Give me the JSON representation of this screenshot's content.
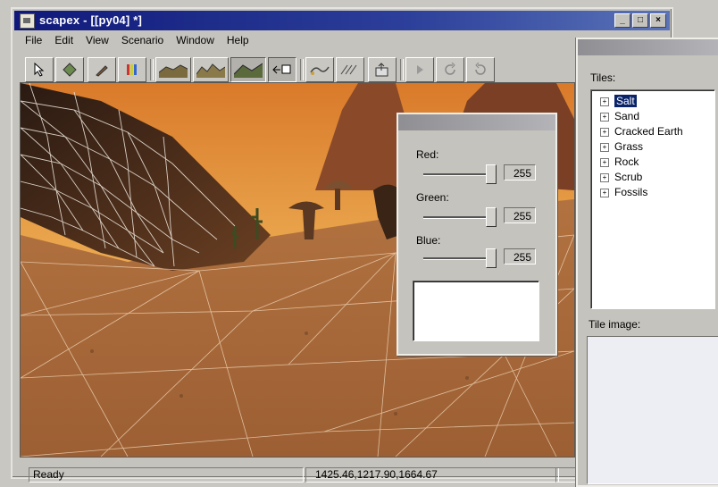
{
  "window": {
    "title": "scapex - [[py04] *]",
    "buttons": {
      "minimize": "_",
      "maximize": "□",
      "close": "×"
    }
  },
  "menu": [
    "File",
    "Edit",
    "View",
    "Scenario",
    "Window",
    "Help"
  ],
  "toolbar": {
    "icons": [
      "select-arrow-icon",
      "diamond-icon",
      "brush-icon",
      "palette-icon",
      "terrain-flat-icon",
      "terrain-rough-icon",
      "terrain-texture-icon",
      "camera-move-icon",
      "wave-curve-icon",
      "ripple-icon",
      "export-icon",
      "play-icon",
      "rotate-cw-icon",
      "rotate-ccw-icon"
    ]
  },
  "color_dialog": {
    "red_label": "Red:",
    "red_value": "255",
    "green_label": "Green:",
    "green_value": "255",
    "blue_label": "Blue:",
    "blue_value": "255",
    "red_level": 1.0,
    "green_level": 1.0,
    "blue_level": 1.0
  },
  "tiles_panel": {
    "tiles_label": "Tiles:",
    "tiles": [
      "Salt",
      "Sand",
      "Cracked Earth",
      "Grass",
      "Rock",
      "Scrub",
      "Fossils"
    ],
    "selected_tile": "Salt",
    "tile_image_label": "Tile image:"
  },
  "status": {
    "text": "Ready",
    "coordinates": "1425.46,1217.90,1664.67"
  },
  "colors": {
    "titlebar": "#10197a",
    "selection": "#0a246a",
    "terrain_sky": "#e2a24a",
    "terrain_ground": "#a4683a"
  }
}
